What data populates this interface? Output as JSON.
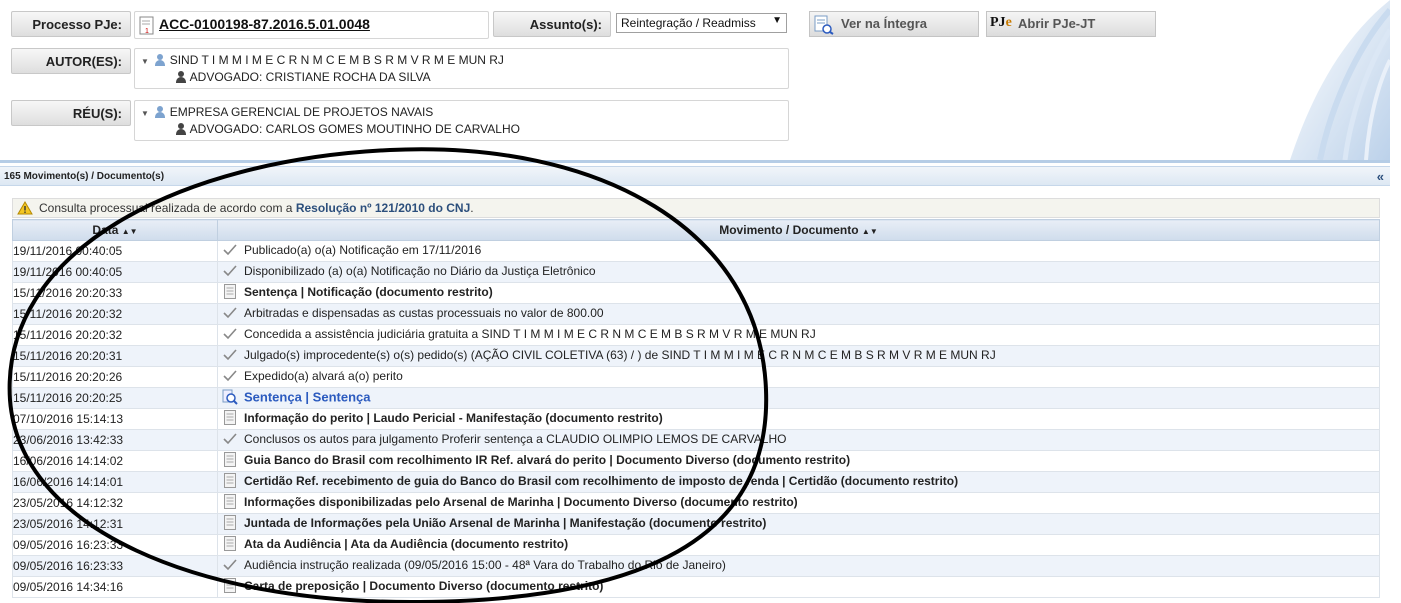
{
  "header": {
    "processo_label": "Processo PJe:",
    "processo_number": "ACC-0100198-87.2016.5.01.0048",
    "assunto_label": "Assunto(s):",
    "assunto_value": "Reintegração / Readmiss",
    "ver_integra_label": "Ver na Íntegra",
    "abrir_pje_label": "Abrir PJe-JT",
    "pje_logo_text": "PJe"
  },
  "autores": {
    "label": "AUTOR(ES):",
    "party": "SIND T I M M I M E C R N M C E M B S R M V R M E MUN RJ",
    "advogado": "ADVOGADO: CRISTIANE ROCHA DA SILVA"
  },
  "reus": {
    "label": "RÉU(S):",
    "party": "EMPRESA GERENCIAL DE PROJETOS NAVAIS",
    "advogado": "ADVOGADO: CARLOS GOMES MOUTINHO DE CARVALHO"
  },
  "panel": {
    "title": "165 Movimento(s) / Documento(s)",
    "collapse_icon": "«"
  },
  "notice": {
    "prefix": "Consulta processual realizada de acordo com a ",
    "link": "Resolução nº 121/2010 do CNJ",
    "suffix": "."
  },
  "table": {
    "col_date": "Data",
    "col_mov": "Movimento / Documento",
    "sort_icon": "▲▼",
    "rows": [
      {
        "date": "19/11/2016 00:40:05",
        "text": "Publicado(a) o(a) Notificação em 17/11/2016",
        "icon": "check-icon",
        "style": "normal"
      },
      {
        "date": "19/11/2016 00:40:05",
        "text": "Disponibilizado (a) o(a) Notificação no Diário da Justiça Eletrônico",
        "icon": "check-icon",
        "style": "normal"
      },
      {
        "date": "15/11/2016 20:20:33",
        "text": "Sentença | Notificação (documento restrito)",
        "icon": "document-icon",
        "style": "bold"
      },
      {
        "date": "15/11/2016 20:20:32",
        "text": "Arbitradas e dispensadas as custas processuais no valor de 800.00",
        "icon": "check-icon",
        "style": "normal"
      },
      {
        "date": "15/11/2016 20:20:32",
        "text": "Concedida a assistência judiciária gratuita a SIND T I M M I M E C R N M C E M B S R M V R M E MUN RJ",
        "icon": "check-icon",
        "style": "normal"
      },
      {
        "date": "15/11/2016 20:20:31",
        "text": "Julgado(s) improcedente(s) o(s) pedido(s) (AÇÃO CIVIL COLETIVA (63) / ) de SIND T I M M I M E C R N M C E M B S R M V R M E MUN RJ",
        "icon": "check-icon",
        "style": "normal"
      },
      {
        "date": "15/11/2016 20:20:26",
        "text": "Expedido(a) alvará a(o) perito",
        "icon": "check-icon",
        "style": "normal"
      },
      {
        "date": "15/11/2016 20:20:25",
        "text": "Sentença | Sentença",
        "icon": "magnifier-icon",
        "style": "link"
      },
      {
        "date": "07/10/2016 15:14:13",
        "text": "Informação do perito | Laudo Pericial - Manifestação (documento restrito)",
        "icon": "document-icon",
        "style": "bold"
      },
      {
        "date": "23/06/2016 13:42:33",
        "text": "Conclusos os autos para julgamento Proferir sentença a CLAUDIO OLIMPIO LEMOS DE CARVALHO",
        "icon": "check-icon",
        "style": "normal"
      },
      {
        "date": "16/06/2016 14:14:02",
        "text": "Guia Banco do Brasil com recolhimento IR Ref. alvará do perito | Documento Diverso (documento restrito)",
        "icon": "document-icon",
        "style": "bold"
      },
      {
        "date": "16/06/2016 14:14:01",
        "text": "Certidão Ref. recebimento de guia do Banco do Brasil com recolhimento de imposto de renda | Certidão (documento restrito)",
        "icon": "document-icon",
        "style": "bold"
      },
      {
        "date": "23/05/2016 14:12:32",
        "text": "Informações disponibilizadas pelo Arsenal de Marinha | Documento Diverso (documento restrito)",
        "icon": "document-icon",
        "style": "bold"
      },
      {
        "date": "23/05/2016 14:12:31",
        "text": "Juntada de Informações pela União Arsenal de Marinha | Manifestação (documento restrito)",
        "icon": "document-icon",
        "style": "bold"
      },
      {
        "date": "09/05/2016 16:23:33",
        "text": "Ata da Audiência | Ata da Audiência (documento restrito)",
        "icon": "document-icon",
        "style": "bold"
      },
      {
        "date": "09/05/2016 16:23:33",
        "text": "Audiência instrução realizada (09/05/2016 15:00 - 48ª Vara do Trabalho do Rio de Janeiro)",
        "icon": "check-icon",
        "style": "normal"
      },
      {
        "date": "09/05/2016 14:34:16",
        "text": "Carta de preposição | Documento Diverso (documento restrito)",
        "icon": "document-icon",
        "style": "bold"
      }
    ]
  },
  "colors": {
    "accent": "#2c4f7c",
    "link": "#2c5bbf",
    "row_alt": "#eef3fa",
    "annotation_oval": "#000000"
  }
}
